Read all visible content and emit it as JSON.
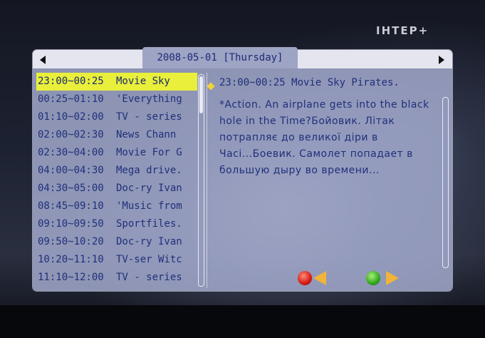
{
  "channel": {
    "logo": "ІНТЕР+"
  },
  "header": {
    "date": "2008-05-01 [Thursday]"
  },
  "programs": [
    {
      "time": "23:00~00:25",
      "title": "Movie Sky",
      "selected": true
    },
    {
      "time": "00:25~01:10",
      "title": "'Everything",
      "selected": false
    },
    {
      "time": "01:10~02:00",
      "title": "TV - series",
      "selected": false
    },
    {
      "time": "02:00~02:30",
      "title": "News Chann",
      "selected": false
    },
    {
      "time": "02:30~04:00",
      "title": "Movie For G",
      "selected": false
    },
    {
      "time": "04:00~04:30",
      "title": "Mega drive.",
      "selected": false
    },
    {
      "time": "04:30~05:00",
      "title": "Doc-ry Ivan",
      "selected": false
    },
    {
      "time": "08:45~09:10",
      "title": "'Music from",
      "selected": false
    },
    {
      "time": "09:10~09:50",
      "title": "Sportfiles.",
      "selected": false
    },
    {
      "time": "09:50~10:20",
      "title": "Doc-ry Ivan",
      "selected": false
    },
    {
      "time": "10:20~11:10",
      "title": "TV-ser Witc",
      "selected": false
    },
    {
      "time": "11:10~12:00",
      "title": "TV - series",
      "selected": false
    }
  ],
  "detail": {
    "heading": "23:00~00:25 Movie Sky Pirates.",
    "description": "*Action. An airplane gets into the black hole in the Time?Бойовик. Літак потрапляє до великої діри в Часі...Боевик. Самолет попадает в большую дыру во времени..."
  },
  "buttons": {
    "red": "red-button",
    "prev": "prev-arrow",
    "green": "green-button",
    "next": "next-arrow"
  },
  "colors": {
    "highlight": "#e9ef3a",
    "text": "#20307a",
    "panel": "#aab2d6"
  }
}
